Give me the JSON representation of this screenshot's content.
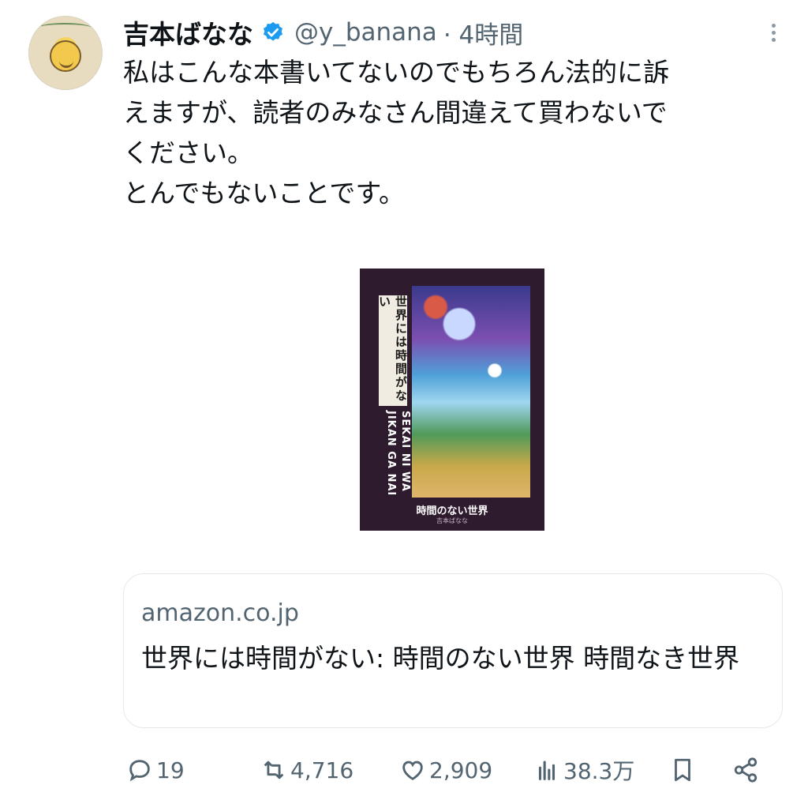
{
  "author": {
    "name": "吉本ばなな",
    "handle": "@y_banana",
    "time": "· 4時間"
  },
  "tweet": {
    "text": "私はこんな本書いてないのでもちろん法的に訴\nえますが、読者のみなさん間違えて買わないで\nください。\nとんでもないことです。"
  },
  "book_cover": {
    "vertical_title": "世界には時間がない",
    "roman_title_line1": "SEKAI NI WA",
    "roman_title_line2": "JIKAN GA NAI",
    "bottom_title": "時間のない世界",
    "bottom_author": "吉本ばなな"
  },
  "link_card": {
    "domain": "amazon.co.jp",
    "title": "世界には時間がない: 時間のない世界 時間なき世界"
  },
  "actions": {
    "replies": "19",
    "retweets": "4,716",
    "likes": "2,909",
    "views": "38.3万"
  },
  "icons": [
    "verified-badge-icon",
    "more-options-icon",
    "reply-icon",
    "retweet-icon",
    "like-icon",
    "views-icon",
    "bookmark-icon",
    "share-icon"
  ],
  "colors": {
    "text": "#0f1419",
    "secondary": "#536471",
    "verified": "#1d9bf0",
    "cover_bg": "#2f1b2e"
  }
}
